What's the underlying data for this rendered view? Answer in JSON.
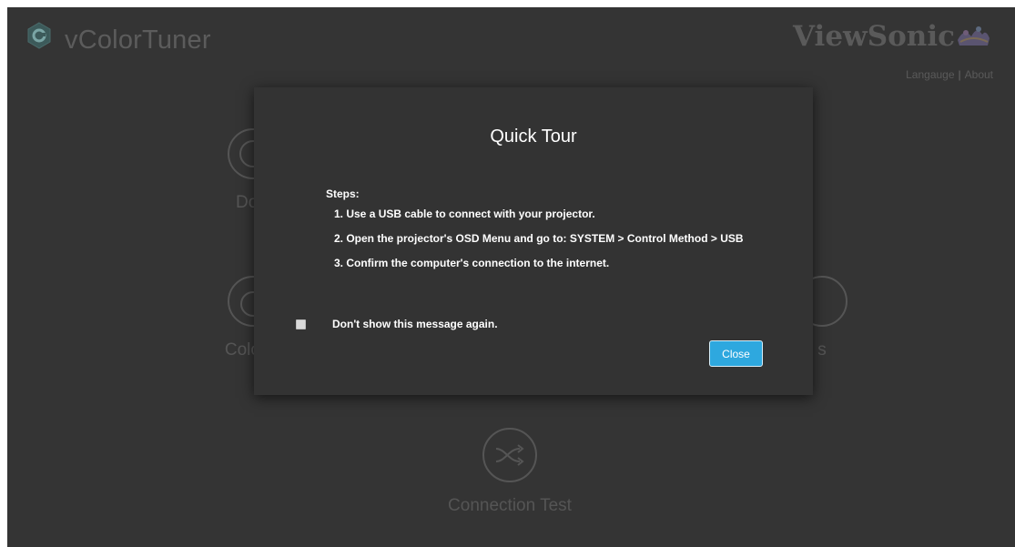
{
  "header": {
    "app_title": "vColorTuner",
    "brand": "ViewSonic",
    "links": {
      "language": "Langauge",
      "separator": "|",
      "about": "About"
    }
  },
  "tiles": {
    "download": {
      "label": "Dow",
      "icon": "download-icon"
    },
    "color": {
      "label": "Color A",
      "icon": "color-adjust-icon"
    },
    "right": {
      "label": "s",
      "icon": "settings-icon"
    },
    "connection": {
      "label": "Connection Test",
      "icon": "shuffle-icon"
    }
  },
  "modal": {
    "title": "Quick Tour",
    "steps_heading": "Steps:",
    "steps": [
      "1. Use a USB cable to connect with your projector.",
      "2. Open the projector's OSD Menu and go to: SYSTEM > Control Method > USB",
      "3. Confirm the computer's connection to the internet."
    ],
    "checkbox_label": "Don't show this message again.",
    "checkbox_checked": false,
    "close_label": "Close"
  },
  "colors": {
    "app_background": "#343434",
    "modal_background": "#333333",
    "accent": "#2ea8df",
    "muted_text": "#5a5a5a"
  }
}
